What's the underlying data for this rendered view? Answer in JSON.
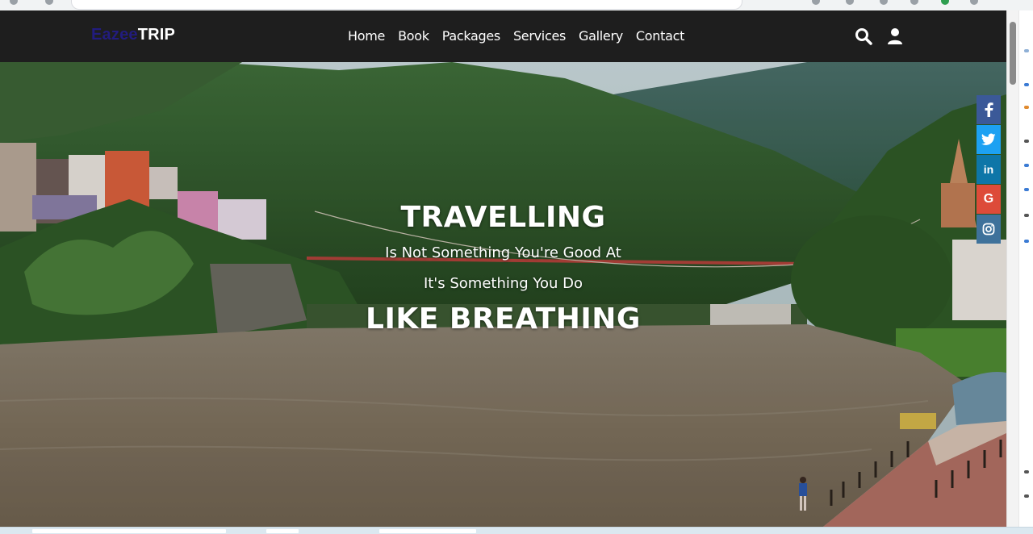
{
  "brand": {
    "part1": "Eazee",
    "part2": "TRIP"
  },
  "nav": {
    "links": [
      "Home",
      "Book",
      "Packages",
      "Services",
      "Gallery",
      "Contact"
    ],
    "search_icon": "search-icon",
    "user_icon": "user-icon"
  },
  "hero": {
    "title": "TRAVELLING",
    "line1": "Is Not Something You're Good At",
    "line2": "It's Something You Do",
    "big": "LIKE BREATHING"
  },
  "social": {
    "items": [
      {
        "icon": "facebook-icon",
        "glyph": "f",
        "color": "#3b5998"
      },
      {
        "icon": "twitter-icon",
        "glyph": "🐦",
        "color": "#1da1f2"
      },
      {
        "icon": "linkedin-icon",
        "glyph": "in",
        "color": "#0e76a8"
      },
      {
        "icon": "google-icon",
        "glyph": "G",
        "color": "#dd4b39"
      },
      {
        "icon": "instagram-icon",
        "glyph": "◎",
        "color": "#3f729b"
      }
    ]
  },
  "colors": {
    "navbar": "#1e1e1e",
    "brand_accent": "#221c7e"
  }
}
